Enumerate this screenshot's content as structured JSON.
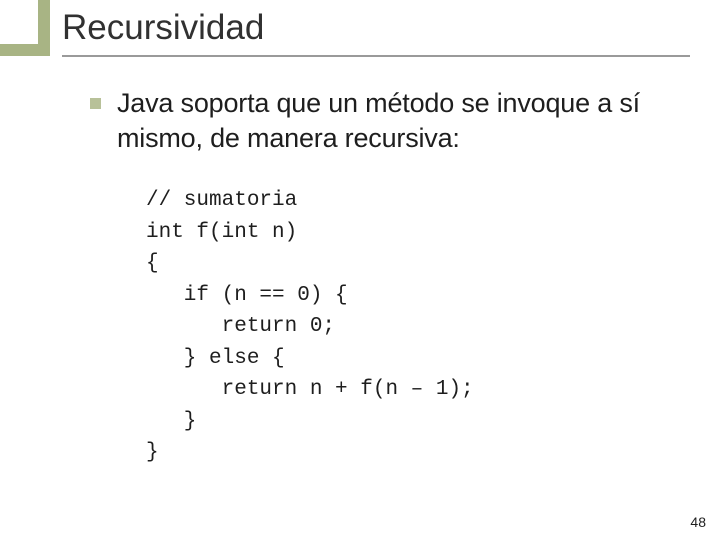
{
  "slide": {
    "title": "Recursividad",
    "bullet_text": "Java soporta que un método se invoque a sí mismo, de manera recursiva:",
    "code": "// sumatoria\nint f(int n)\n{\n   if (n == 0) {\n      return 0;\n   } else {\n      return n + f(n – 1);\n   }\n}",
    "page_number": "48"
  }
}
